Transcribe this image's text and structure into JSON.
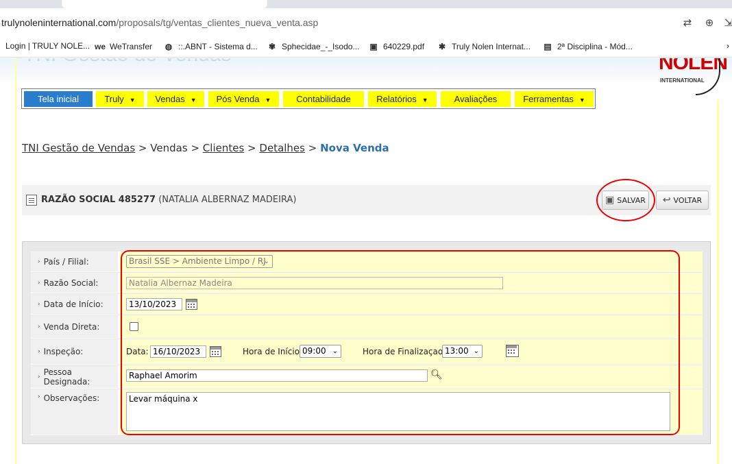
{
  "browser": {
    "url_host": "trulynoleninternational.com",
    "url_path": "/proposals/tg/ventas_clientes_nueva_venta.asp",
    "bookmarks": [
      {
        "label": "Login | TRULY NOLE..."
      },
      {
        "label": "WeTransfer",
        "icon": "we"
      },
      {
        "label": "::.ABNT - Sistema d..."
      },
      {
        "label": "Sphecidae_-_Isodo..."
      },
      {
        "label": "640229.pdf"
      },
      {
        "label": "Truly Nolen Internat..."
      },
      {
        "label": "2ª Disciplina - Mód..."
      }
    ]
  },
  "app": {
    "title": "TNI Gestão de Vendas",
    "logo_text": "NOLEN",
    "logo_sub": "INTERNATIONAL"
  },
  "menu": [
    {
      "label": "Tela inicial",
      "active": true
    },
    {
      "label": "Truly",
      "has_caret": true
    },
    {
      "label": "Vendas",
      "has_caret": true
    },
    {
      "label": "Pós Venda",
      "has_caret": true
    },
    {
      "label": "Contabilidade",
      "has_caret": false
    },
    {
      "label": "Relatórios",
      "has_caret": true
    },
    {
      "label": "Avaliações",
      "has_caret": false
    },
    {
      "label": "Ferramentas",
      "has_caret": true
    }
  ],
  "breadcrumb": {
    "root": "TNI Gestão de Vendas",
    "sep": ">",
    "vendas": "Vendas",
    "clientes": "Clientes",
    "detalhes": "Detalhes",
    "current": "Nova Venda"
  },
  "header": {
    "title_bold": "RAZÃO SOCIAL 485277",
    "title_rest": "(NATALIA ALBERNAZ MADEIRA)",
    "save_label": "SALVAR",
    "back_label": "VOLTAR"
  },
  "form": {
    "pais_label": "País / Filial:",
    "pais_value": "Brasil SSE > Ambiente Limpo / RJ",
    "razao_label": "Razão Social:",
    "razao_value": "Natalia Albernaz Madeira",
    "data_inicio_label": "Data de Início:",
    "data_inicio_value": "13/10/2023",
    "venda_direta_label": "Venda Direta:",
    "venda_direta_checked": false,
    "inspecao_label": "Inspeção:",
    "inspecao_data_label": "Data:",
    "inspecao_data_value": "16/10/2023",
    "hora_inicio_label": "Hora de Início:",
    "hora_inicio_value": "09:00",
    "hora_fim_label": "Hora de Finalizaçao:",
    "hora_fim_value": "13:00",
    "pessoa_label": "Pessoa Designada:",
    "pessoa_value": "Raphael Amorim",
    "obs_label": "Observações:",
    "obs_value": "Levar máquina x"
  },
  "colors": {
    "menu_yellow": "#ffff00",
    "menu_active": "#2a7ccc",
    "form_row": "#ffffcc",
    "annotation_red": "#e00000",
    "breadcrumb_current": "#2f6fa7"
  }
}
